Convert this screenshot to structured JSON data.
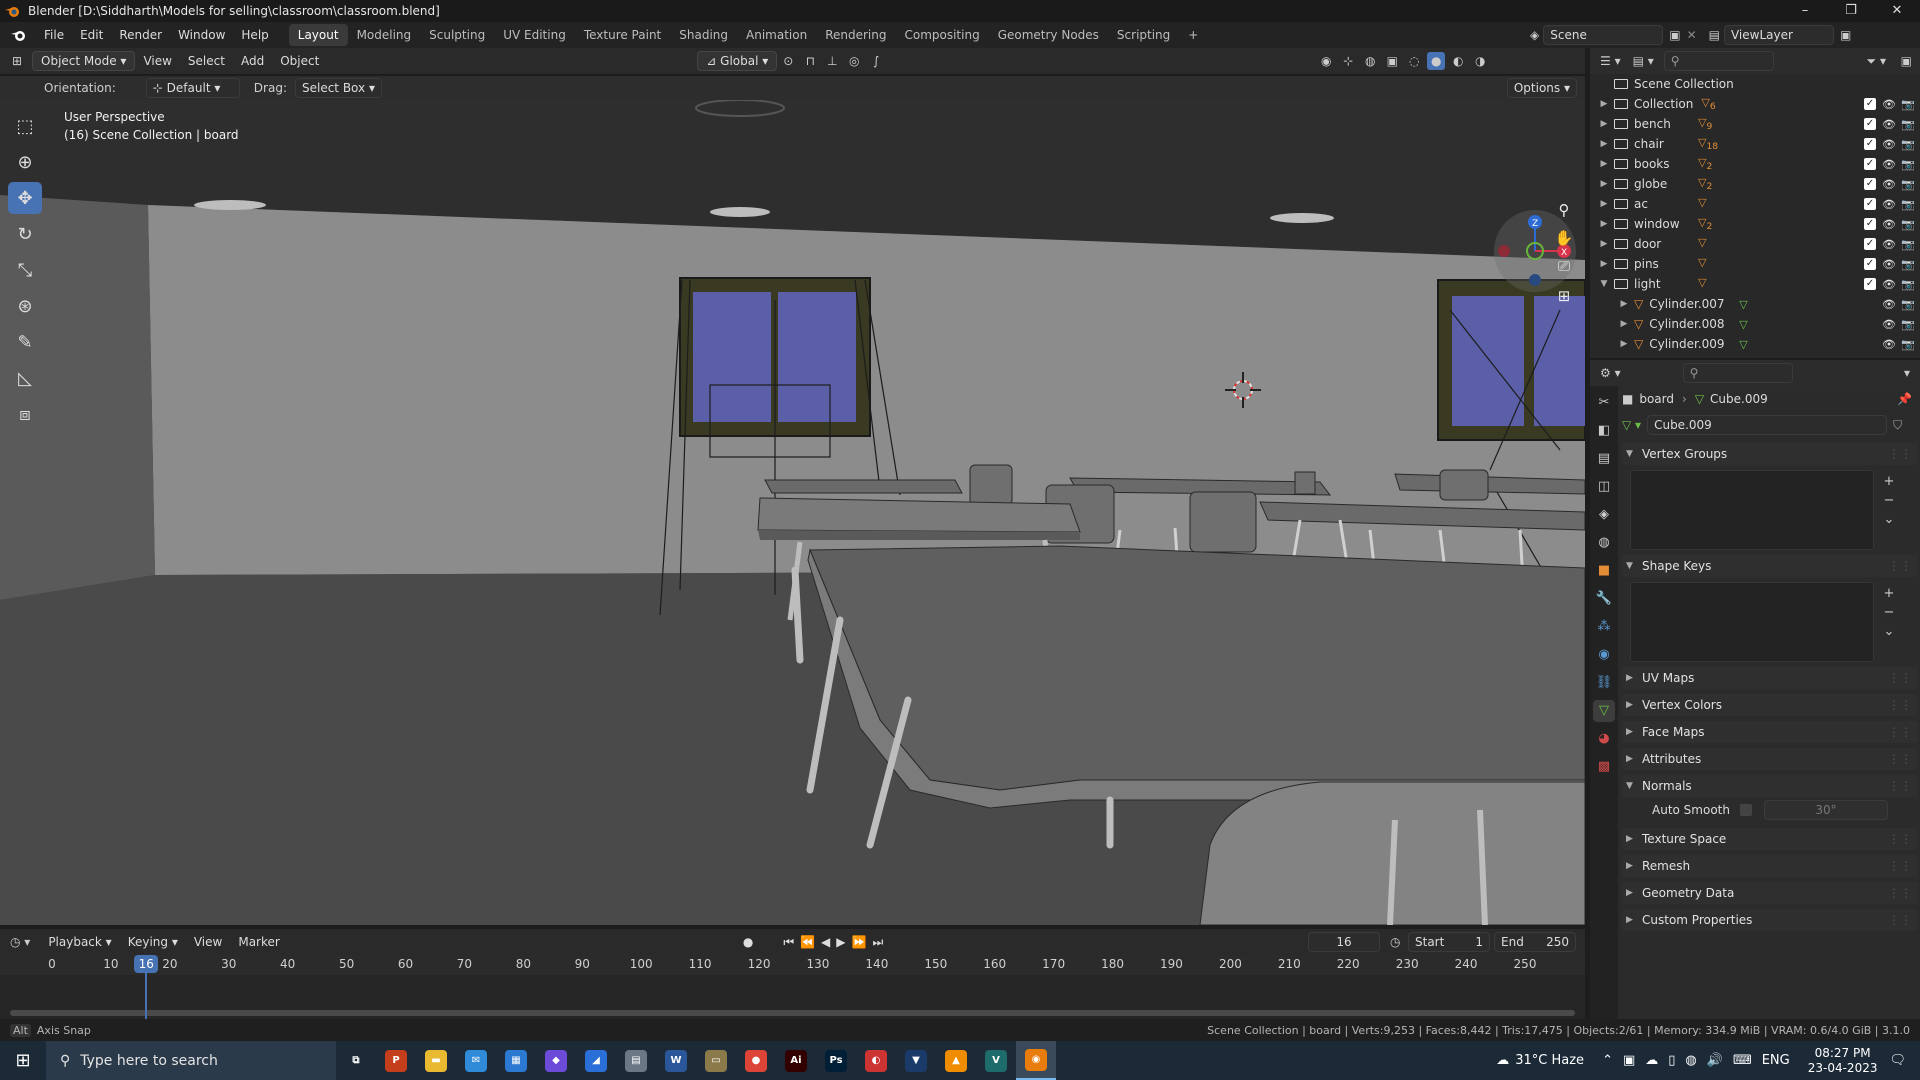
{
  "window": {
    "title": "Blender [D:\\Siddharth\\Models for selling\\classroom\\classroom.blend]",
    "controls": [
      "–",
      "❐",
      "✕"
    ]
  },
  "menu": [
    "File",
    "Edit",
    "Render",
    "Window",
    "Help"
  ],
  "workspaces": [
    "Layout",
    "Modeling",
    "Sculpting",
    "UV Editing",
    "Texture Paint",
    "Shading",
    "Animation",
    "Rendering",
    "Compositing",
    "Geometry Nodes",
    "Scripting",
    "+"
  ],
  "active_workspace": "Layout",
  "scene_name": "Scene",
  "view_layer": "ViewLayer",
  "viewport_header": {
    "mode": "Object Mode",
    "menus": [
      "View",
      "Select",
      "Add",
      "Object"
    ],
    "transform_orientation": "Global"
  },
  "tool_settings": {
    "orientation_label": "Orientation:",
    "orientation_value": "Default",
    "drag_label": "Drag:",
    "drag_value": "Select Box",
    "options": "Options"
  },
  "viewport_overlay": {
    "perspective": "User Perspective",
    "context": "(16) Scene Collection | board"
  },
  "gizmo": {
    "z": "Z",
    "x": "X"
  },
  "outliner": {
    "root": "Scene Collection",
    "items": [
      {
        "name": "Collection",
        "count": "6",
        "expanded": false,
        "level": 0
      },
      {
        "name": "bench",
        "count": "9",
        "expanded": false,
        "level": 0
      },
      {
        "name": "chair",
        "count": "18",
        "expanded": false,
        "level": 0
      },
      {
        "name": "books",
        "count": "2",
        "expanded": false,
        "level": 0
      },
      {
        "name": "globe",
        "count": "2",
        "expanded": false,
        "level": 0
      },
      {
        "name": "ac",
        "count": "",
        "expanded": false,
        "level": 0
      },
      {
        "name": "window",
        "count": "2",
        "expanded": false,
        "level": 0
      },
      {
        "name": "door",
        "count": "",
        "expanded": false,
        "level": 0
      },
      {
        "name": "pins",
        "count": "",
        "expanded": false,
        "level": 0
      },
      {
        "name": "light",
        "count": "",
        "expanded": true,
        "level": 0
      },
      {
        "name": "Cylinder.007",
        "count": "",
        "expanded": false,
        "level": 1
      },
      {
        "name": "Cylinder.008",
        "count": "",
        "expanded": false,
        "level": 1
      },
      {
        "name": "Cylinder.009",
        "count": "",
        "expanded": false,
        "level": 1
      }
    ]
  },
  "properties": {
    "breadcrumb_object": "board",
    "breadcrumb_data": "Cube.009",
    "mesh_name": "Cube.009",
    "sections": [
      {
        "label": "Vertex Groups",
        "open": true,
        "list": true
      },
      {
        "label": "Shape Keys",
        "open": true,
        "list": true
      },
      {
        "label": "UV Maps",
        "open": false
      },
      {
        "label": "Vertex Colors",
        "open": false
      },
      {
        "label": "Face Maps",
        "open": false
      },
      {
        "label": "Attributes",
        "open": false
      },
      {
        "label": "Normals",
        "open": true
      },
      {
        "label": "Texture Space",
        "open": false
      },
      {
        "label": "Remesh",
        "open": false
      },
      {
        "label": "Geometry Data",
        "open": false
      },
      {
        "label": "Custom Properties",
        "open": false
      }
    ],
    "auto_smooth_label": "Auto Smooth",
    "auto_smooth_angle": "30°"
  },
  "timeline": {
    "menus": [
      "Playback",
      "Keying",
      "View",
      "Marker"
    ],
    "current_frame": "16",
    "start_label": "Start",
    "start": "1",
    "end_label": "End",
    "end": "250",
    "ticks": [
      "0",
      "10",
      "20",
      "30",
      "40",
      "50",
      "60",
      "70",
      "80",
      "90",
      "100",
      "110",
      "120",
      "130",
      "140",
      "150",
      "160",
      "170",
      "180",
      "190",
      "200",
      "210",
      "220",
      "230",
      "240",
      "250"
    ],
    "playhead": "16"
  },
  "statusbar": {
    "left_key": "Alt",
    "left": "Axis Snap",
    "right": "Scene Collection | board | Verts:9,253 | Faces:8,442 | Tris:17,475 | Objects:2/61 | Memory: 334.9 MiB | VRAM: 0.6/4.0 GiB | 3.1.0"
  },
  "taskbar": {
    "search_placeholder": "Type here to search",
    "apps": [
      {
        "name": "task-view",
        "label": "⧉",
        "color": "#1c2a38"
      },
      {
        "name": "powerpoint",
        "label": "P",
        "color": "#c43e1c"
      },
      {
        "name": "file-explorer",
        "label": "▬",
        "color": "#e8b931"
      },
      {
        "name": "outlook",
        "label": "✉",
        "color": "#2f8ad8"
      },
      {
        "name": "store",
        "label": "▦",
        "color": "#2b79d0"
      },
      {
        "name": "copilot",
        "label": "◆",
        "color": "#6b4bd8"
      },
      {
        "name": "app-blue",
        "label": "◢",
        "color": "#2a6ed8"
      },
      {
        "name": "app-gray",
        "label": "▤",
        "color": "#6b7785"
      },
      {
        "name": "word",
        "label": "W",
        "color": "#2b579a"
      },
      {
        "name": "app-folder",
        "label": "▭",
        "color": "#8a7a4a"
      },
      {
        "name": "chrome",
        "label": "●",
        "color": "#db4437"
      },
      {
        "name": "illustrator",
        "label": "Ai",
        "color": "#330000"
      },
      {
        "name": "photoshop",
        "label": "Ps",
        "color": "#001e36"
      },
      {
        "name": "app-red",
        "label": "◐",
        "color": "#c33"
      },
      {
        "name": "vpn",
        "label": "▼",
        "color": "#1a3a6a"
      },
      {
        "name": "vlc",
        "label": "▲",
        "color": "#f08c00"
      },
      {
        "name": "app-v",
        "label": "V",
        "color": "#1d6b6b"
      },
      {
        "name": "blender",
        "label": "◉",
        "color": "#e87d0d"
      }
    ],
    "weather": "31°C  Haze",
    "language": "ENG",
    "time": "08:27 PM",
    "date": "23-04-2023"
  },
  "colors": {
    "accent": "#4772b3",
    "mesh_icon": "#e38d36",
    "window_glass": "#5a5fa8"
  }
}
